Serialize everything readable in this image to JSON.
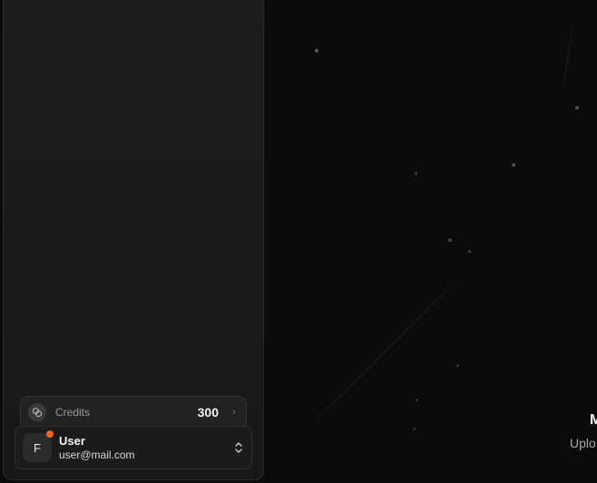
{
  "sidebar": {
    "credits": {
      "label": "Credits",
      "value": "300"
    },
    "user": {
      "initial": "F",
      "name": "User",
      "email": "user@mail.com"
    }
  },
  "main": {
    "title_fragment": "M",
    "subtitle_fragment": "Uplo"
  },
  "colors": {
    "status_dot": "#f0641e",
    "sidebar_bg": "#1c1c1c",
    "page_bg": "#0b0b0b"
  }
}
